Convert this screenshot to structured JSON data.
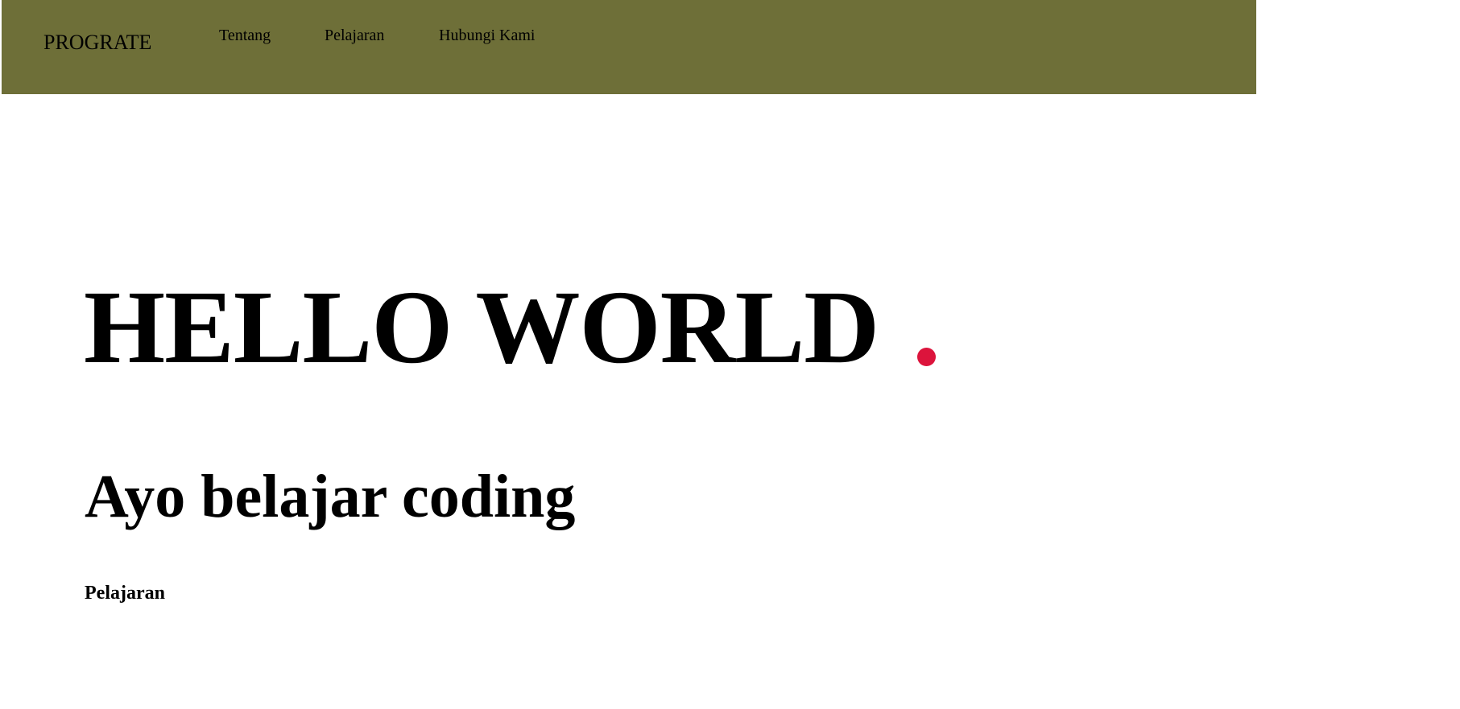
{
  "colors": {
    "navbar_bg": "#6e6f38",
    "accent_dot": "#dc143c",
    "text": "#000000",
    "page_bg": "#ffffff"
  },
  "header": {
    "brand": "PROGRATE",
    "nav": [
      {
        "label": "Tentang"
      },
      {
        "label": "Pelajaran"
      },
      {
        "label": "Hubungi Kami"
      }
    ]
  },
  "hero": {
    "title": "HELLO WORLD",
    "subtitle": "Ayo belajar coding"
  },
  "sections": {
    "first_label": "Pelajaran"
  }
}
